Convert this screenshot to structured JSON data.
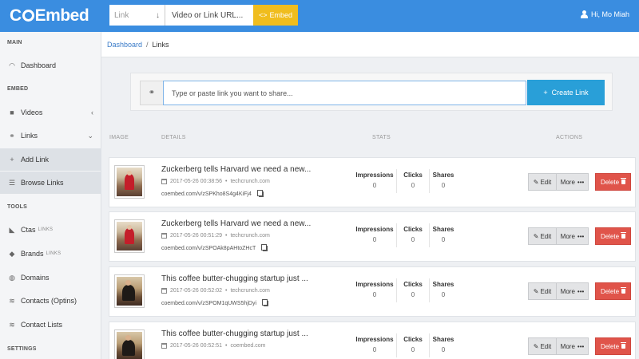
{
  "header": {
    "logo": "COEmbed",
    "logo_pre": "C",
    "logo_post": "Embed",
    "type_select": "Link",
    "url_placeholder": "Video or Link URL...",
    "embed_label": "Embed",
    "user_label": "Hi, Mo Miah"
  },
  "sidebar": {
    "sections": [
      "MAIN",
      "EMBED",
      "TOOLS",
      "SETTINGS"
    ],
    "items": [
      {
        "label": "Dashboard",
        "icon": "gauge-icon"
      },
      {
        "label": "Videos",
        "icon": "video-camera-icon"
      },
      {
        "label": "Links",
        "icon": "link-icon"
      },
      {
        "label": "Add Link",
        "icon": "plus-icon"
      },
      {
        "label": "Browse Links",
        "icon": "list-icon"
      },
      {
        "label": "Ctas",
        "badge": "LINKS",
        "icon": "megaphone-icon"
      },
      {
        "label": "Brands",
        "badge": "LINKS",
        "icon": "tag-icon"
      },
      {
        "label": "Domains",
        "icon": "globe-icon"
      },
      {
        "label": "Contacts (Optins)",
        "icon": "database-icon"
      },
      {
        "label": "Contact Lists",
        "icon": "database-icon"
      }
    ]
  },
  "breadcrumb": {
    "root": "Dashboard",
    "separator": "/",
    "current": "Links"
  },
  "create": {
    "placeholder": "Type or paste link you want to share...",
    "button_label": "Create Link"
  },
  "columns": {
    "image": "IMAGE",
    "details": "DETAILS",
    "stats": "STATS",
    "actions": "ACTIONS"
  },
  "stat_labels": {
    "impressions": "Impressions",
    "clicks": "Clicks",
    "shares": "Shares"
  },
  "action_labels": {
    "edit": "Edit",
    "more": "More",
    "delete": "Delete"
  },
  "links": [
    {
      "title": "Zuckerberg tells Harvard we need a new...",
      "date": "2017-05-26 00:38:56",
      "source": "techcrunch.com",
      "short_url": "coembed.com/v/zSPKho8S4g4KiFj4",
      "impressions": "0",
      "clicks": "0",
      "shares": "0"
    },
    {
      "title": "Zuckerberg tells Harvard we need a new...",
      "date": "2017-05-26 00:51:29",
      "source": "techcrunch.com",
      "short_url": "coembed.com/v/zSPOAk8pAHtoZHcT",
      "impressions": "0",
      "clicks": "0",
      "shares": "0"
    },
    {
      "title": "This coffee butter-chugging startup just ...",
      "date": "2017-05-26 00:52:02",
      "source": "techcrunch.com",
      "short_url": "coembed.com/v/zSPOM1qUWS5hjDyi",
      "impressions": "0",
      "clicks": "0",
      "shares": "0"
    },
    {
      "title": "This coffee butter-chugging startup just ...",
      "date": "2017-05-26 00:52:51",
      "source": "coembed.com",
      "short_url": "",
      "impressions": "0",
      "clicks": "0",
      "shares": "0"
    }
  ],
  "colors": {
    "topbar": "#3a8de0",
    "embed_button": "#f0bd1e",
    "create_button": "#299fd8",
    "delete_button": "#e0544a"
  }
}
